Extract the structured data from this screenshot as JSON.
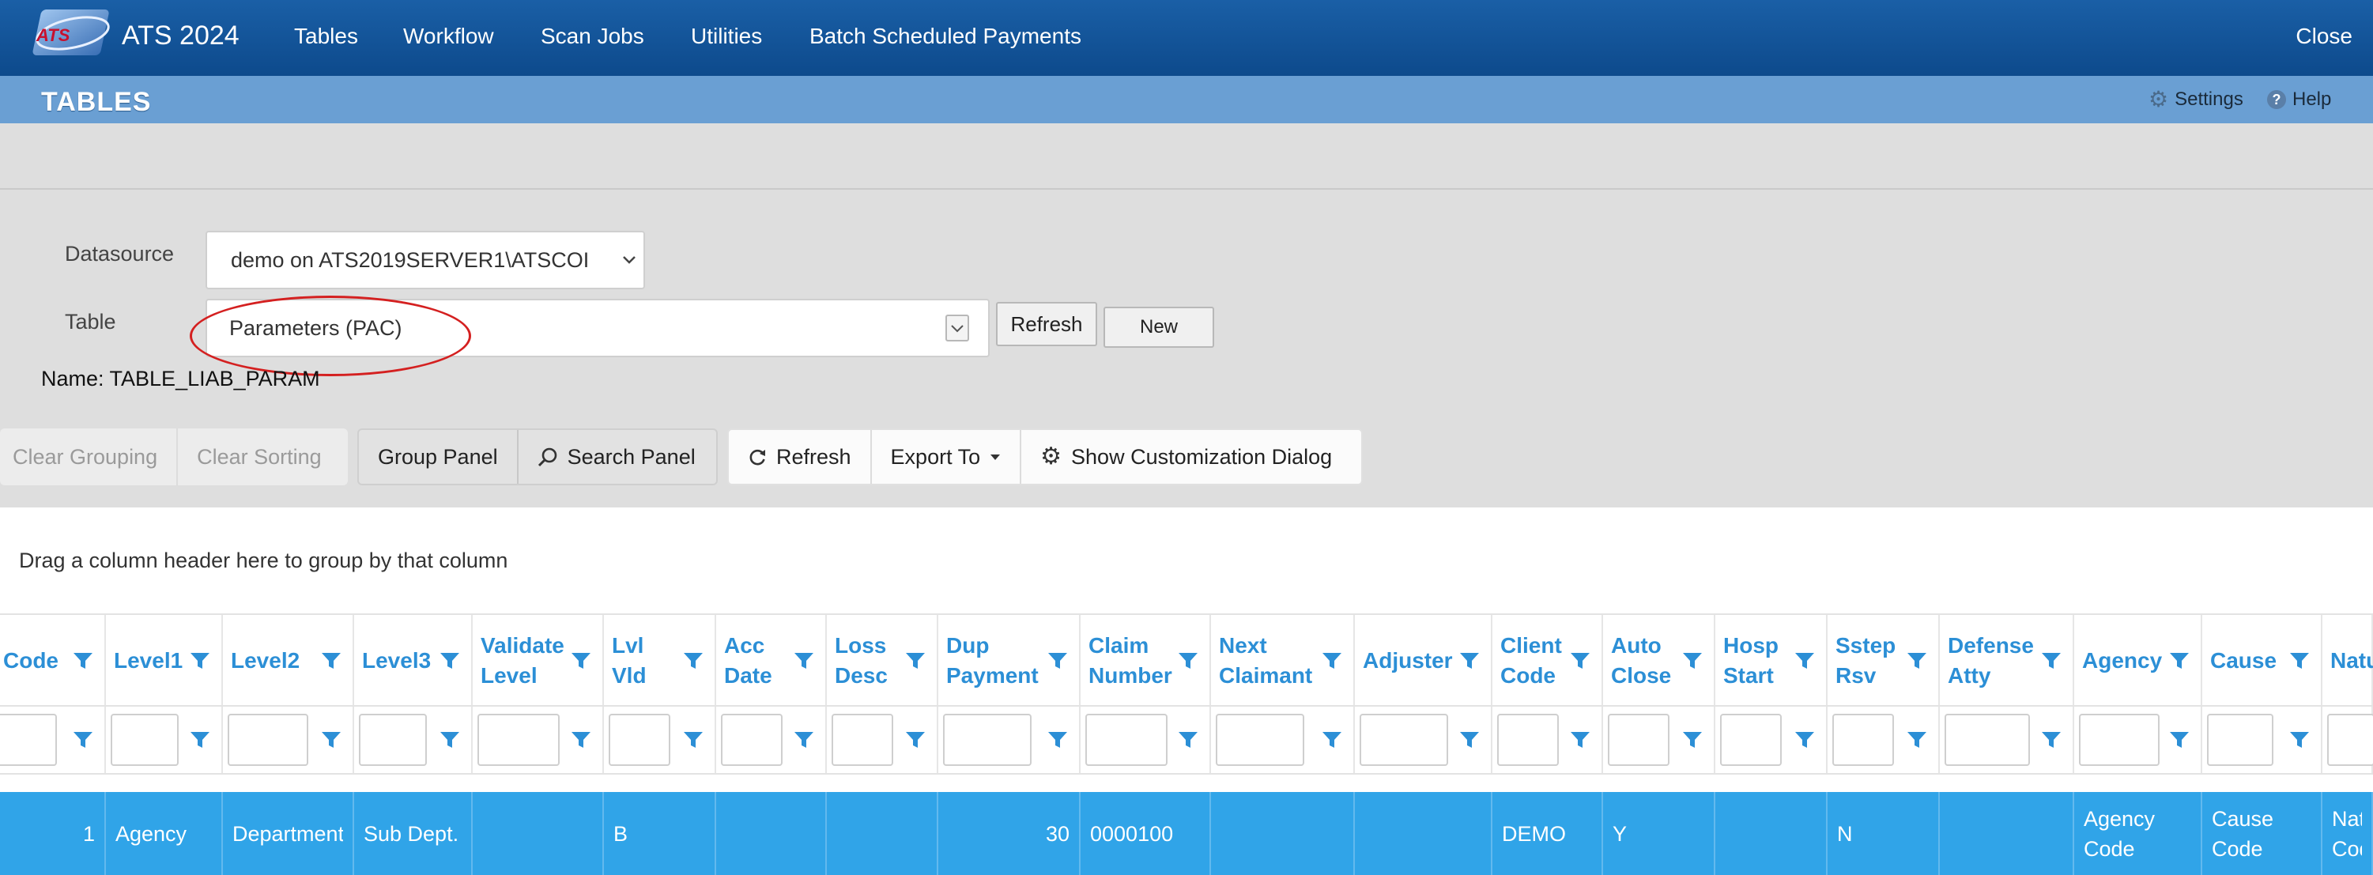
{
  "app": {
    "title": "ATS 2024",
    "logo_text": "ATS",
    "close_label": "Close",
    "nav": [
      "Tables",
      "Workflow",
      "Scan Jobs",
      "Utilities",
      "Batch Scheduled Payments"
    ]
  },
  "page": {
    "title": "TABLES",
    "settings_label": "Settings",
    "help_label": "Help"
  },
  "form": {
    "datasource_label": "Datasource",
    "datasource_value": "demo on ATS2019SERVER1\\ATSCOI",
    "table_label": "Table",
    "table_value": "Parameters (PAC)",
    "refresh_label": "Refresh",
    "new_label": "New",
    "name_line": "Name: TABLE_LIAB_PARAM"
  },
  "toolbar": {
    "clear_grouping": "Clear Grouping",
    "clear_sorting": "Clear Sorting",
    "group_panel": "Group Panel",
    "search_panel": "Search Panel",
    "refresh": "Refresh",
    "export_to": "Export To",
    "customize": "Show Customization Dialog"
  },
  "grid": {
    "group_hint": "Drag a column header here to group by that column",
    "columns": [
      "Code",
      "Level1",
      "Level2",
      "Level3",
      "Validate\nLevel",
      "Lvl\nVld",
      "Acc\nDate",
      "Loss\nDesc",
      "Dup\nPayment",
      "Claim\nNumber",
      "Next\nClaimant",
      "Adjuster",
      "Client\nCode",
      "Auto\nClose",
      "Hosp\nStart",
      "Sstep\nRsv",
      "Defense\nAtty",
      "Agency",
      "Cause",
      "Natu"
    ],
    "rows": [
      [
        "1",
        "Agency",
        "Department",
        "Sub Dept.",
        "",
        "B",
        "",
        "",
        "30",
        "0000100",
        "",
        "",
        "DEMO",
        "Y",
        "",
        "N",
        "",
        "Agency\nCode",
        "Cause\nCode",
        "Natu\nCode"
      ]
    ]
  },
  "colors": {
    "nav_bg": "#0d4a8c",
    "page_header_bg": "#6a9fd3",
    "header_text": "#2c8fd6",
    "selected_row": "#30a4e8",
    "highlight_ellipse": "#d42020"
  },
  "icons": {
    "settings": "gear-icon",
    "help": "help-icon",
    "filter": "filter-icon",
    "refresh": "refresh-icon",
    "search": "search-icon",
    "customize": "gear-icon",
    "dropdown": "chevron-down-icon"
  }
}
